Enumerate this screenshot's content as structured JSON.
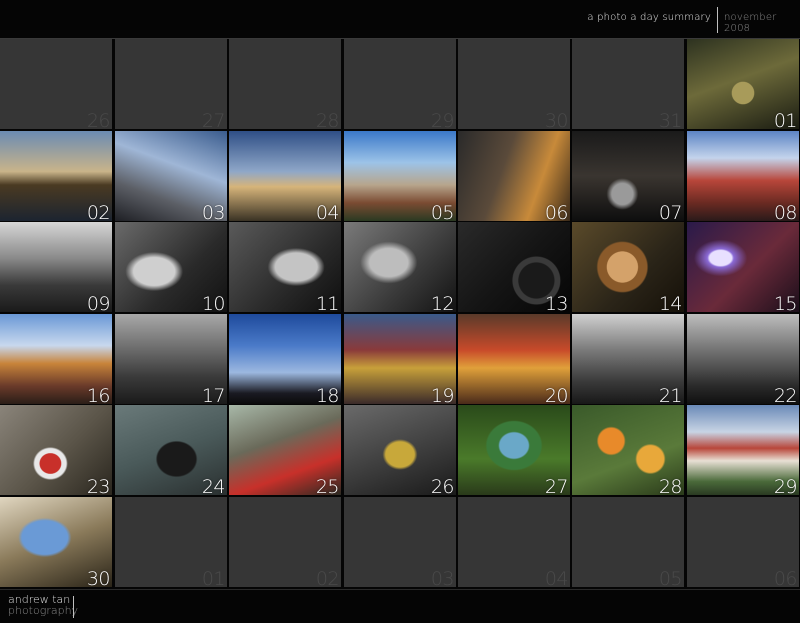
{
  "header": {
    "title": "a photo a day summary",
    "month": "november 2008"
  },
  "footer": {
    "name": "andrew tan",
    "subtitle": "photography"
  },
  "rows": [
    [
      "26",
      "27",
      "28",
      "29",
      "30",
      "31",
      "01"
    ],
    [
      "02",
      "03",
      "04",
      "05",
      "06",
      "07",
      "08"
    ],
    [
      "09",
      "10",
      "11",
      "12",
      "13",
      "14",
      "15"
    ],
    [
      "16",
      "17",
      "18",
      "19",
      "20",
      "21",
      "22"
    ],
    [
      "23",
      "24",
      "25",
      "26",
      "27",
      "28",
      "29"
    ],
    [
      "30",
      "01",
      "02",
      "03",
      "04",
      "05",
      "06"
    ]
  ],
  "photo_descriptions": {
    "0-6": "car interior steering wheel",
    "1-0": "river skyline sunset",
    "1-1": "suspension bridge",
    "1-2": "pagoda at dusk",
    "1-3": "city skyline buildings",
    "1-4": "building facade and balconies",
    "1-5": "wet street at night",
    "1-6": "red shophouses",
    "2-0": "market umbrellas monochrome",
    "2-1": "statue face monochrome",
    "2-2": "statue face monochrome",
    "2-3": "carved statue monochrome",
    "2-4": "lumix camera",
    "2-5": "dried rose",
    "2-6": "action figure with light",
    "3-0": "colorful shophouses",
    "3-1": "old buildings monochrome",
    "3-2": "sky silhouettes",
    "3-3": "stall with toys",
    "3-4": "fruit market",
    "3-5": "person walking monochrome",
    "3-6": "stairs alley monochrome",
    "4-0": "cigarette pack on ground",
    "4-1": "old television in room",
    "4-2": "cluttered room",
    "4-3": "yellow bollard",
    "4-4": "potted plant",
    "4-5": "orange flowers",
    "4-6": "red roof hotel",
    "5-0": "blue plush toy"
  },
  "photos": [
    [
      false,
      false,
      false,
      false,
      false,
      false,
      true
    ],
    [
      true,
      true,
      true,
      true,
      true,
      true,
      true
    ],
    [
      true,
      true,
      true,
      true,
      true,
      true,
      true
    ],
    [
      true,
      true,
      true,
      true,
      true,
      true,
      true
    ],
    [
      true,
      true,
      true,
      true,
      true,
      true,
      true
    ],
    [
      true,
      false,
      false,
      false,
      false,
      false,
      false
    ]
  ],
  "colors": {
    "background": "#050505",
    "blank_cell": "#363636",
    "blank_number": "#4a4a4a",
    "photo_number": "#ffffff"
  }
}
